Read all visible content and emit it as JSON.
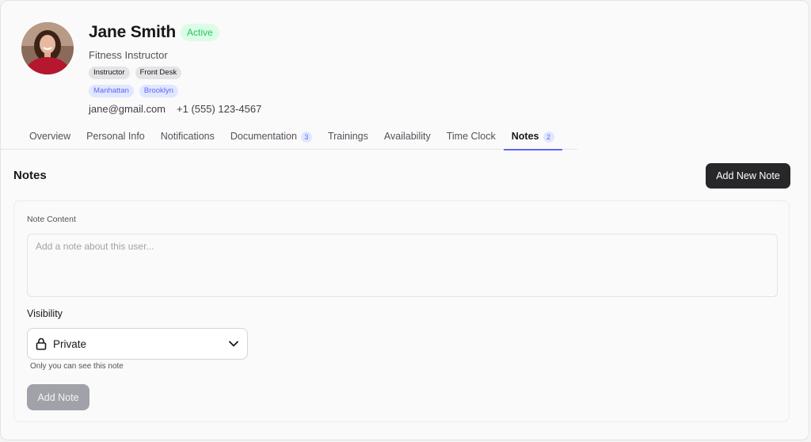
{
  "profile": {
    "name": "Jane Smith",
    "status": "Active",
    "title": "Fitness Instructor",
    "roles": [
      "Instructor",
      "Front Desk"
    ],
    "locations": [
      "Manhattan",
      "Brooklyn"
    ],
    "email": "jane@gmail.com",
    "phone": "+1 (555) 123-4567"
  },
  "tabs": [
    {
      "label": "Overview",
      "count": null
    },
    {
      "label": "Personal Info",
      "count": null
    },
    {
      "label": "Notifications",
      "count": null
    },
    {
      "label": "Documentation",
      "count": "3"
    },
    {
      "label": "Trainings",
      "count": null
    },
    {
      "label": "Availability",
      "count": null
    },
    {
      "label": "Time Clock",
      "count": null
    },
    {
      "label": "Notes",
      "count": "2",
      "active": true
    }
  ],
  "notes": {
    "section_title": "Notes",
    "add_new_label": "Add New Note",
    "content_label": "Note Content",
    "content_placeholder": "Add a note about this user...",
    "content_value": "",
    "visibility_label": "Visibility",
    "visibility_value": "Private",
    "visibility_icon": "lock-icon",
    "visibility_helper": "Only you can see this note",
    "submit_label": "Add Note"
  },
  "colors": {
    "accent": "#6366f1",
    "status_bg": "#dcfce7",
    "status_text": "#22c55e",
    "primary_button": "#27272a",
    "disabled_button": "#a1a1aa"
  }
}
